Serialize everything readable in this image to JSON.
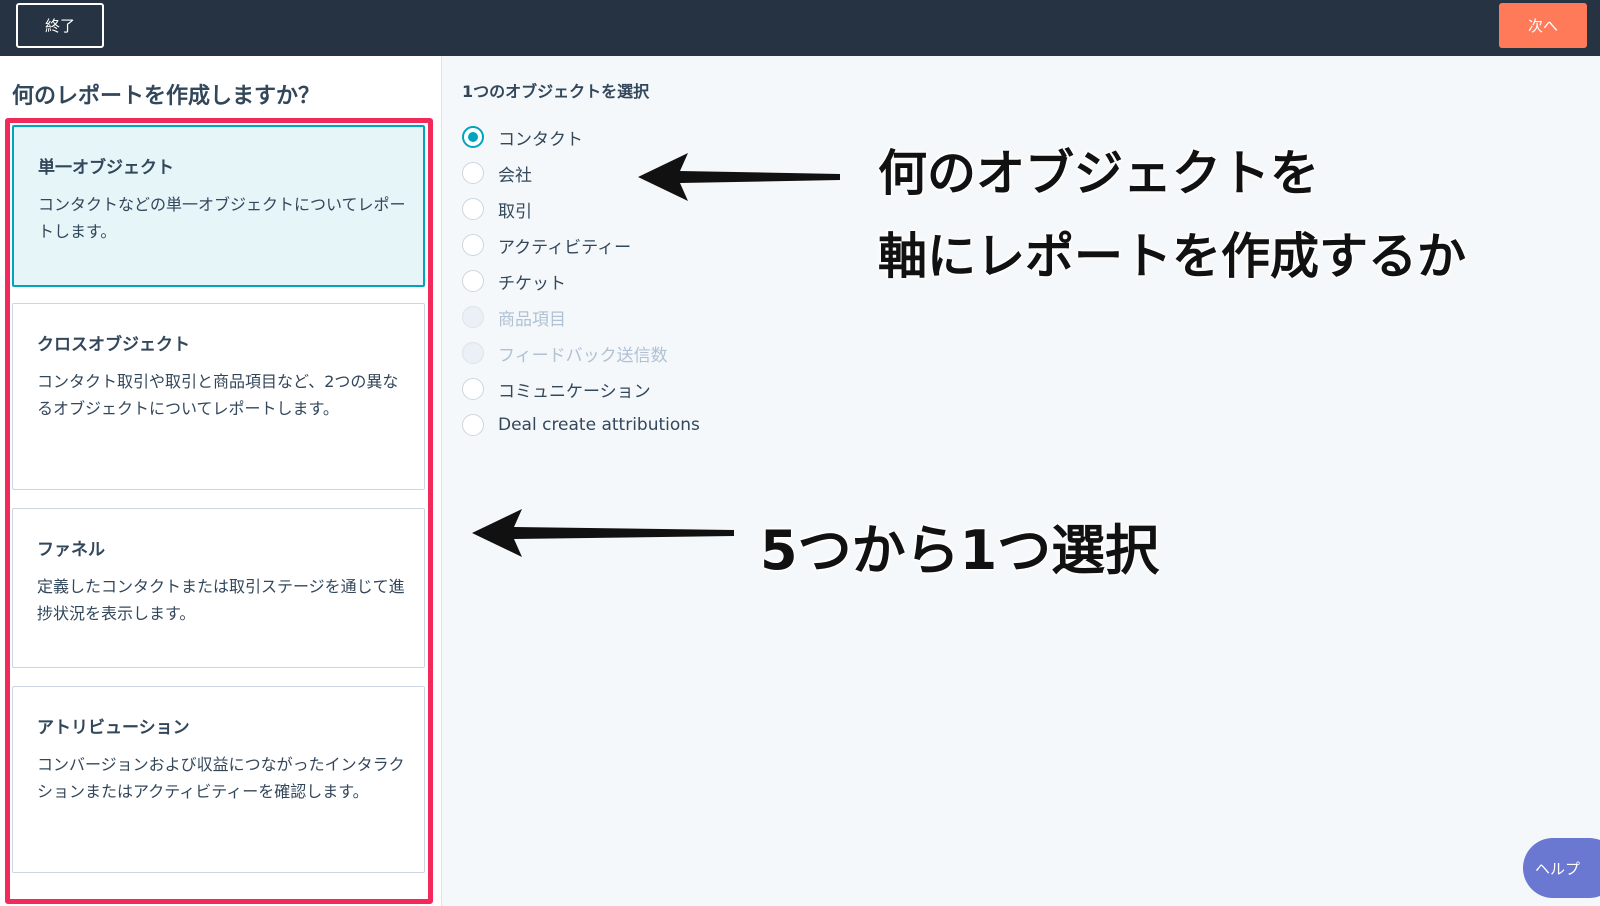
{
  "header": {
    "exit_label": "終了",
    "next_label": "次へ"
  },
  "sidebar": {
    "title": "何のレポートを作成しますか？",
    "cards": [
      {
        "title": "単一オブジェクト",
        "description": "コンタクトなどの単一オブジェクトについてレポートします。",
        "selected": true
      },
      {
        "title": "クロスオブジェクト",
        "description": "コンタクト取引や取引と商品項目など、2つの異なるオブジェクトについてレポートします。",
        "selected": false
      },
      {
        "title": "ファネル",
        "description": "定義したコンタクトまたは取引ステージを通じて進捗状況を表示します。",
        "selected": false
      },
      {
        "title": "アトリビューション",
        "description": "コンバージョンおよび収益につながったインタラクションまたはアクティビティーを確認します。",
        "selected": false
      }
    ]
  },
  "main": {
    "section_label": "1つのオブジェクトを選択",
    "options": [
      {
        "label": "コンタクト",
        "checked": true,
        "disabled": false
      },
      {
        "label": "会社",
        "checked": false,
        "disabled": false
      },
      {
        "label": "取引",
        "checked": false,
        "disabled": false
      },
      {
        "label": "アクティビティー",
        "checked": false,
        "disabled": false
      },
      {
        "label": "チケット",
        "checked": false,
        "disabled": false
      },
      {
        "label": "商品項目",
        "checked": false,
        "disabled": true
      },
      {
        "label": "フィードバック送信数",
        "checked": false,
        "disabled": true
      },
      {
        "label": "コミュニケーション",
        "checked": false,
        "disabled": false
      },
      {
        "label": "Deal create attributions",
        "checked": false,
        "disabled": false
      }
    ]
  },
  "annotations": {
    "object_line1": "何のオブジェクトを",
    "object_line2": "軸にレポートを作成するか",
    "choose": "5つから1つ選択"
  },
  "help": {
    "label": "ヘルプ"
  },
  "colors": {
    "topbar": "#253342",
    "accent": "#00a4bd",
    "next_button": "#ff7a59",
    "highlight_frame": "#f2295b",
    "help_button": "#6a78d1"
  }
}
